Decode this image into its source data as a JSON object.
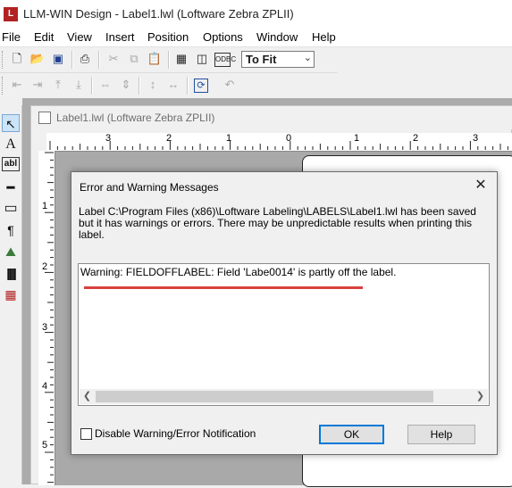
{
  "window": {
    "title": "LLM-WIN Design - Label1.lwl (Loftware Zebra ZPLII)",
    "app_icon_glyph": "L"
  },
  "menu": [
    "File",
    "Edit",
    "View",
    "Insert",
    "Position",
    "Options",
    "Window",
    "Help"
  ],
  "toolbar": {
    "row1_icons": [
      "new-file-icon",
      "open-folder-icon",
      "save-icon",
      "print-icon",
      "cut-icon",
      "copy-icon",
      "paste-icon",
      "grid-icon",
      "properties-icon",
      "odbc-icon"
    ],
    "zoom_value": "To Fit",
    "row2_icons": [
      "align-left-icon",
      "align-right-icon",
      "align-top-icon",
      "align-bottom-icon",
      "space-horizontal-icon",
      "space-vertical-icon",
      "center-vertical-icon",
      "center-horizontal-icon",
      "rotate-icon",
      "undo-icon"
    ]
  },
  "palette": {
    "tools": [
      "select-arrow-icon",
      "text-tool-icon",
      "field-tool-icon",
      "line-tool-icon",
      "box-tool-icon",
      "paragraph-tool-icon",
      "image-tool-icon",
      "barcode-tool-icon",
      "rfid-tool-icon"
    ]
  },
  "document": {
    "title": "Label1.lwl (Loftware Zebra ZPLII)",
    "ruler_h_labels": [
      "3",
      "2",
      "1",
      "0",
      "1",
      "2",
      "3"
    ],
    "ruler_v_labels": [
      "1",
      "2",
      "3",
      "4",
      "5"
    ]
  },
  "dialog": {
    "title": "Error and Warning Messages",
    "message": "Label C:\\Program Files (x86)\\Loftware Labeling\\LABELS\\Label1.lwl has been saved but it has warnings or errors.  There may be unpredictable results when printing this label.",
    "warnings": [
      "Warning: FIELDOFFLABEL: Field 'Labe0014' is partly off the label."
    ],
    "checkbox_label": "Disable Warning/Error Notification",
    "checkbox_checked": false,
    "ok_label": "OK",
    "help_label": "Help",
    "highlight_color": "#d9413e"
  }
}
